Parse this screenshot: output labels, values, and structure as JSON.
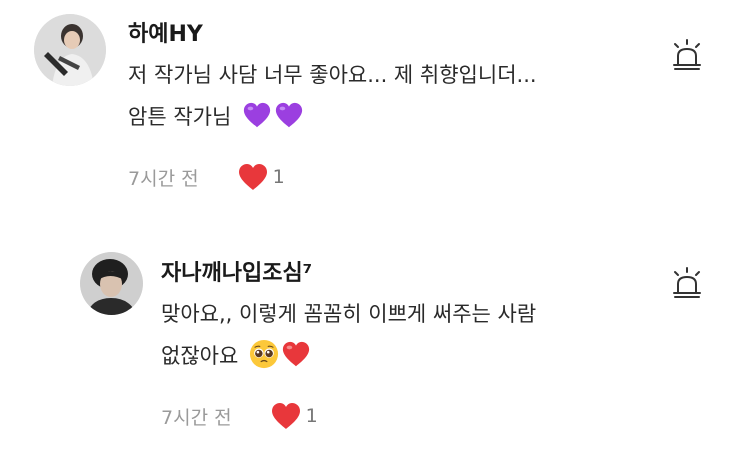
{
  "comments": [
    {
      "author": "하예HY",
      "lines": [
        "저 작가님 사담 너무 좋아요... 제 취향입니더...",
        "암튼 작가님"
      ],
      "emojis": [
        "purple-heart-emoji",
        "purple-heart-emoji"
      ],
      "time": "7시간 전",
      "like_count": "1"
    },
    {
      "author": "자나깨나입조심⁷",
      "lines": [
        "맞아요,, 이렇게 꼼꼼히 이쁘게 써주는 사람",
        "없잖아요"
      ],
      "emojis": [
        "pleading-face-emoji",
        "red-heart-emoji"
      ],
      "time": "7시간 전",
      "like_count": "1"
    }
  ],
  "colors": {
    "purple_heart": "#9b3fe0",
    "red_heart": "#e8373b",
    "muted_text": "#9a9a9a"
  },
  "icons": {
    "report": "siren-icon",
    "like": "heart-icon"
  }
}
